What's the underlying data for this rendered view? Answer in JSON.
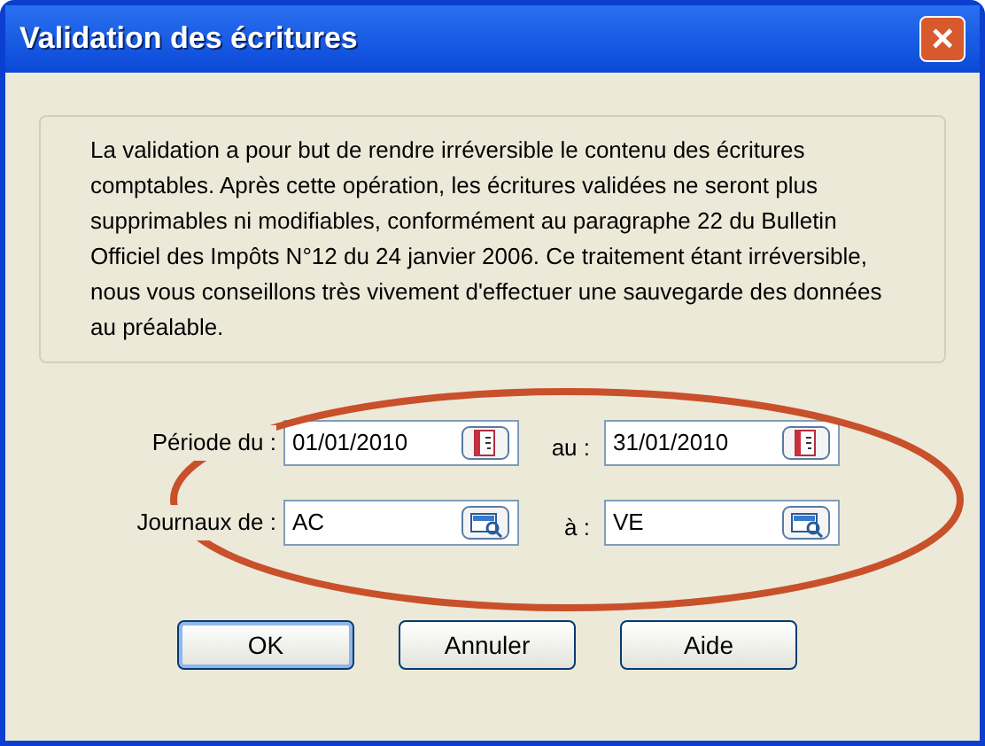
{
  "window": {
    "title": "Validation des écritures",
    "close": "×"
  },
  "notice": "La validation a pour but de rendre irréversible le contenu des écritures comptables. Après cette opération, les écritures validées ne seront plus supprimables ni modifiables, conformément au paragraphe 22 du Bulletin Officiel des Impôts N°12 du 24 janvier 2006. Ce traitement étant irréversible, nous vous conseillons très vivement d'effectuer une sauvegarde des données au préalable.",
  "rows": [
    {
      "label": "Période du :",
      "from": "01/01/2010",
      "to_label": "au :",
      "to": "31/01/2010",
      "kind": "date"
    },
    {
      "label": "Journaux de :",
      "from": "AC",
      "to_label": "à :",
      "to": "VE",
      "kind": "lookup"
    }
  ],
  "buttons": [
    {
      "label": "OK",
      "default": true
    },
    {
      "label": "Annuler",
      "default": false
    },
    {
      "label": "Aide",
      "default": false
    }
  ]
}
